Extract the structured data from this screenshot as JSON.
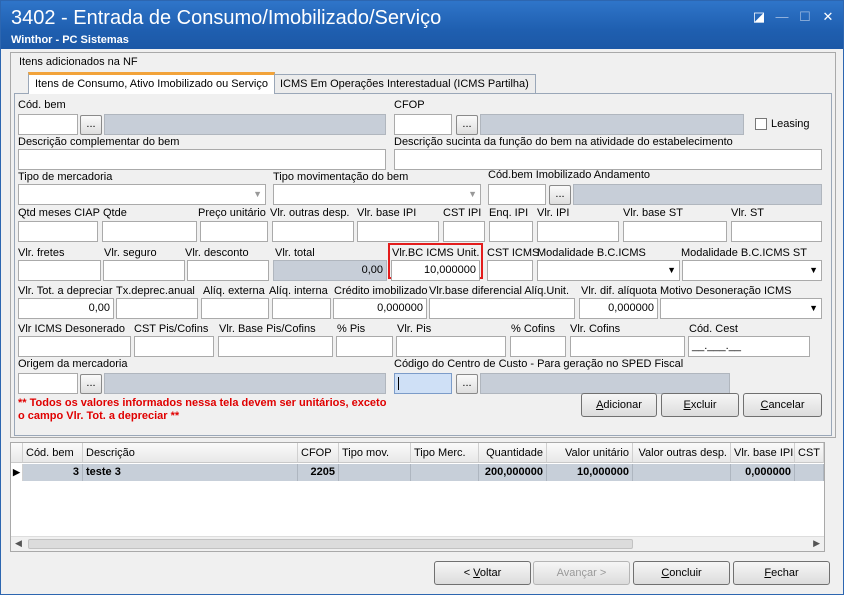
{
  "window": {
    "title": "3402 - Entrada de Consumo/Imobilizado/Serviço",
    "subtitle": "Winthor - PC Sistemas",
    "ctrl_restore": "◪",
    "ctrl_min": "—",
    "ctrl_max": "☐",
    "ctrl_close": "✕"
  },
  "panel": {
    "title": "Itens adicionados na NF"
  },
  "tabs": [
    "Itens de Consumo,  Ativo Imobilizado ou Serviço",
    "ICMS Em Operações Interestadual (ICMS Partilha)"
  ],
  "labels": {
    "cod_bem": "Cód. bem",
    "cfop": "CFOP",
    "leasing": "Leasing",
    "desc_compl": "Descrição complementar do bem",
    "desc_func": "Descrição sucinta da função do bem na atividade do estabelecimento",
    "tipo_merc": "Tipo de mercadoria",
    "tipo_mov": "Tipo movimentação do bem",
    "cod_imob": "Cód.bem Imobilizado Andamento",
    "qtd_meses": "Qtd meses CIAP",
    "qtde": "Qtde",
    "preco_unit": "Preço unitário",
    "vlr_outras": "Vlr. outras desp.",
    "vlr_base_ipi": "Vlr. base IPI",
    "cst_ipi": "CST IPI",
    "enq_ipi": "Enq. IPI",
    "vlr_ipi": "Vlr. IPI",
    "vlr_base_st": "Vlr. base ST",
    "vlr_st": "Vlr. ST",
    "vlr_fretes": "Vlr. fretes",
    "vlr_seguro": "Vlr. seguro",
    "vlr_desconto": "Vlr. desconto",
    "vlr_total": "Vlr. total",
    "vlr_bc_icms": "Vlr.BC ICMS Unit.",
    "cst_icms": "CST ICMS",
    "mod_bc_icms": "Modalidade B.C.ICMS",
    "mod_bc_icms_st": "Modalidade B.C.ICMS ST",
    "vlr_tot_depr": "Vlr. Tot. a depreciar",
    "tx_depr": "Tx.deprec.anual",
    "aliq_ext": "Alíq. externa",
    "aliq_int": "Alíq. interna",
    "cred_imob": "Crédito imobilizado",
    "vlr_base_dif": "Vlr.base diferencial Alíq.Unit.",
    "vlr_dif_aliq": "Vlr. dif. alíquota",
    "motivo_des": "Motivo Desoneração ICMS",
    "vlr_icms_des": "Vlr ICMS Desonerado",
    "cst_pis": "CST Pis/Cofins",
    "vlr_base_pis": "Vlr. Base Pis/Cofins",
    "pct_pis": "% Pis",
    "vlr_pis": "Vlr. Pis",
    "pct_cofins": "% Cofins",
    "vlr_cofins": "Vlr. Cofins",
    "cod_cest": "Cód. Cest",
    "origem": "Origem da mercadoria",
    "centro_custo": "Código do Centro de Custo - Para geração no SPED Fiscal"
  },
  "values": {
    "vlr_total": "0,00",
    "vlr_bc_icms": "10,000000",
    "vlr_tot_depr": "0,00",
    "cred_imob": "0,000000",
    "vlr_dif_aliq": "0,000000",
    "cod_cest": "__.___.__"
  },
  "lookup_button": "...",
  "warning": "** Todos os valores informados nessa tela devem ser unitários, exceto o campo Vlr. Tot. a depreciar **",
  "actions": {
    "adicionar": [
      "A",
      "dicionar"
    ],
    "excluir": [
      "E",
      "xcluir"
    ],
    "cancelar": [
      "C",
      "ancelar"
    ]
  },
  "grid": {
    "headers": [
      "Cód. bem",
      "Descrição",
      "CFOP",
      "Tipo mov.",
      "Tipo Merc.",
      "Quantidade",
      "Valor unitário",
      "Valor outras desp.",
      "Vlr. base IPI",
      "CST I"
    ],
    "row_marker": "▶",
    "rows": [
      [
        "3",
        "teste 3",
        "2205",
        "",
        "",
        "200,000000",
        "10,000000",
        "",
        "0,000000",
        ""
      ]
    ]
  },
  "scroll": {
    "left": "◀",
    "right": "▶"
  },
  "footer": {
    "voltar": [
      "< ",
      "V",
      "oltar"
    ],
    "avancar": "Avançar >",
    "concluir": [
      "C",
      "oncluir"
    ],
    "fechar": [
      "F",
      "echar"
    ]
  },
  "colors": {
    "title_bar": "#1f5fb0",
    "highlight_border": "#e31c1c",
    "warning_text": "#e00000",
    "active_tab_accent": "#f2a33a"
  }
}
